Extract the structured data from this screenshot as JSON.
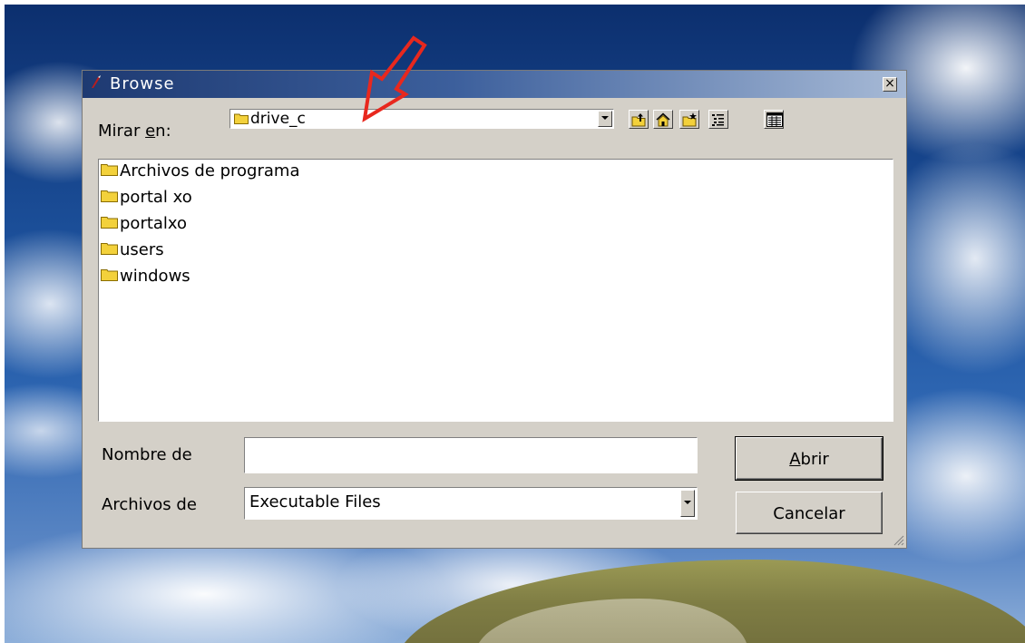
{
  "window": {
    "title": "Browse",
    "close_label": "×"
  },
  "toolbar": {
    "lookin_label_pre": "Mirar ",
    "lookin_label_key": "e",
    "lookin_label_post": "n:",
    "lookin_value": "drive_c",
    "buttons": [
      "up-folder-icon",
      "home-icon",
      "new-folder-icon",
      "list-view-icon",
      "detail-view-icon"
    ]
  },
  "file_list": {
    "items": [
      {
        "name": "Archivos de programa",
        "icon": "folder-icon"
      },
      {
        "name": "portal xo",
        "icon": "folder-icon"
      },
      {
        "name": "portalxo",
        "icon": "folder-icon"
      },
      {
        "name": "users",
        "icon": "folder-icon"
      },
      {
        "name": "windows",
        "icon": "folder-icon"
      }
    ]
  },
  "form": {
    "filename_label": "Nombre de",
    "filename_value": "",
    "filetype_label": "Archivos de",
    "filetype_value": "Executable Files"
  },
  "buttons": {
    "open_key": "A",
    "open_rest": "brir",
    "cancel": "Cancelar"
  },
  "colors": {
    "titlebar_start": "#1e3a72",
    "titlebar_end": "#a7bad6",
    "dialog_bg": "#d4d0c8",
    "annotation_arrow": "#e8281e",
    "folder": "#f3d13b"
  }
}
